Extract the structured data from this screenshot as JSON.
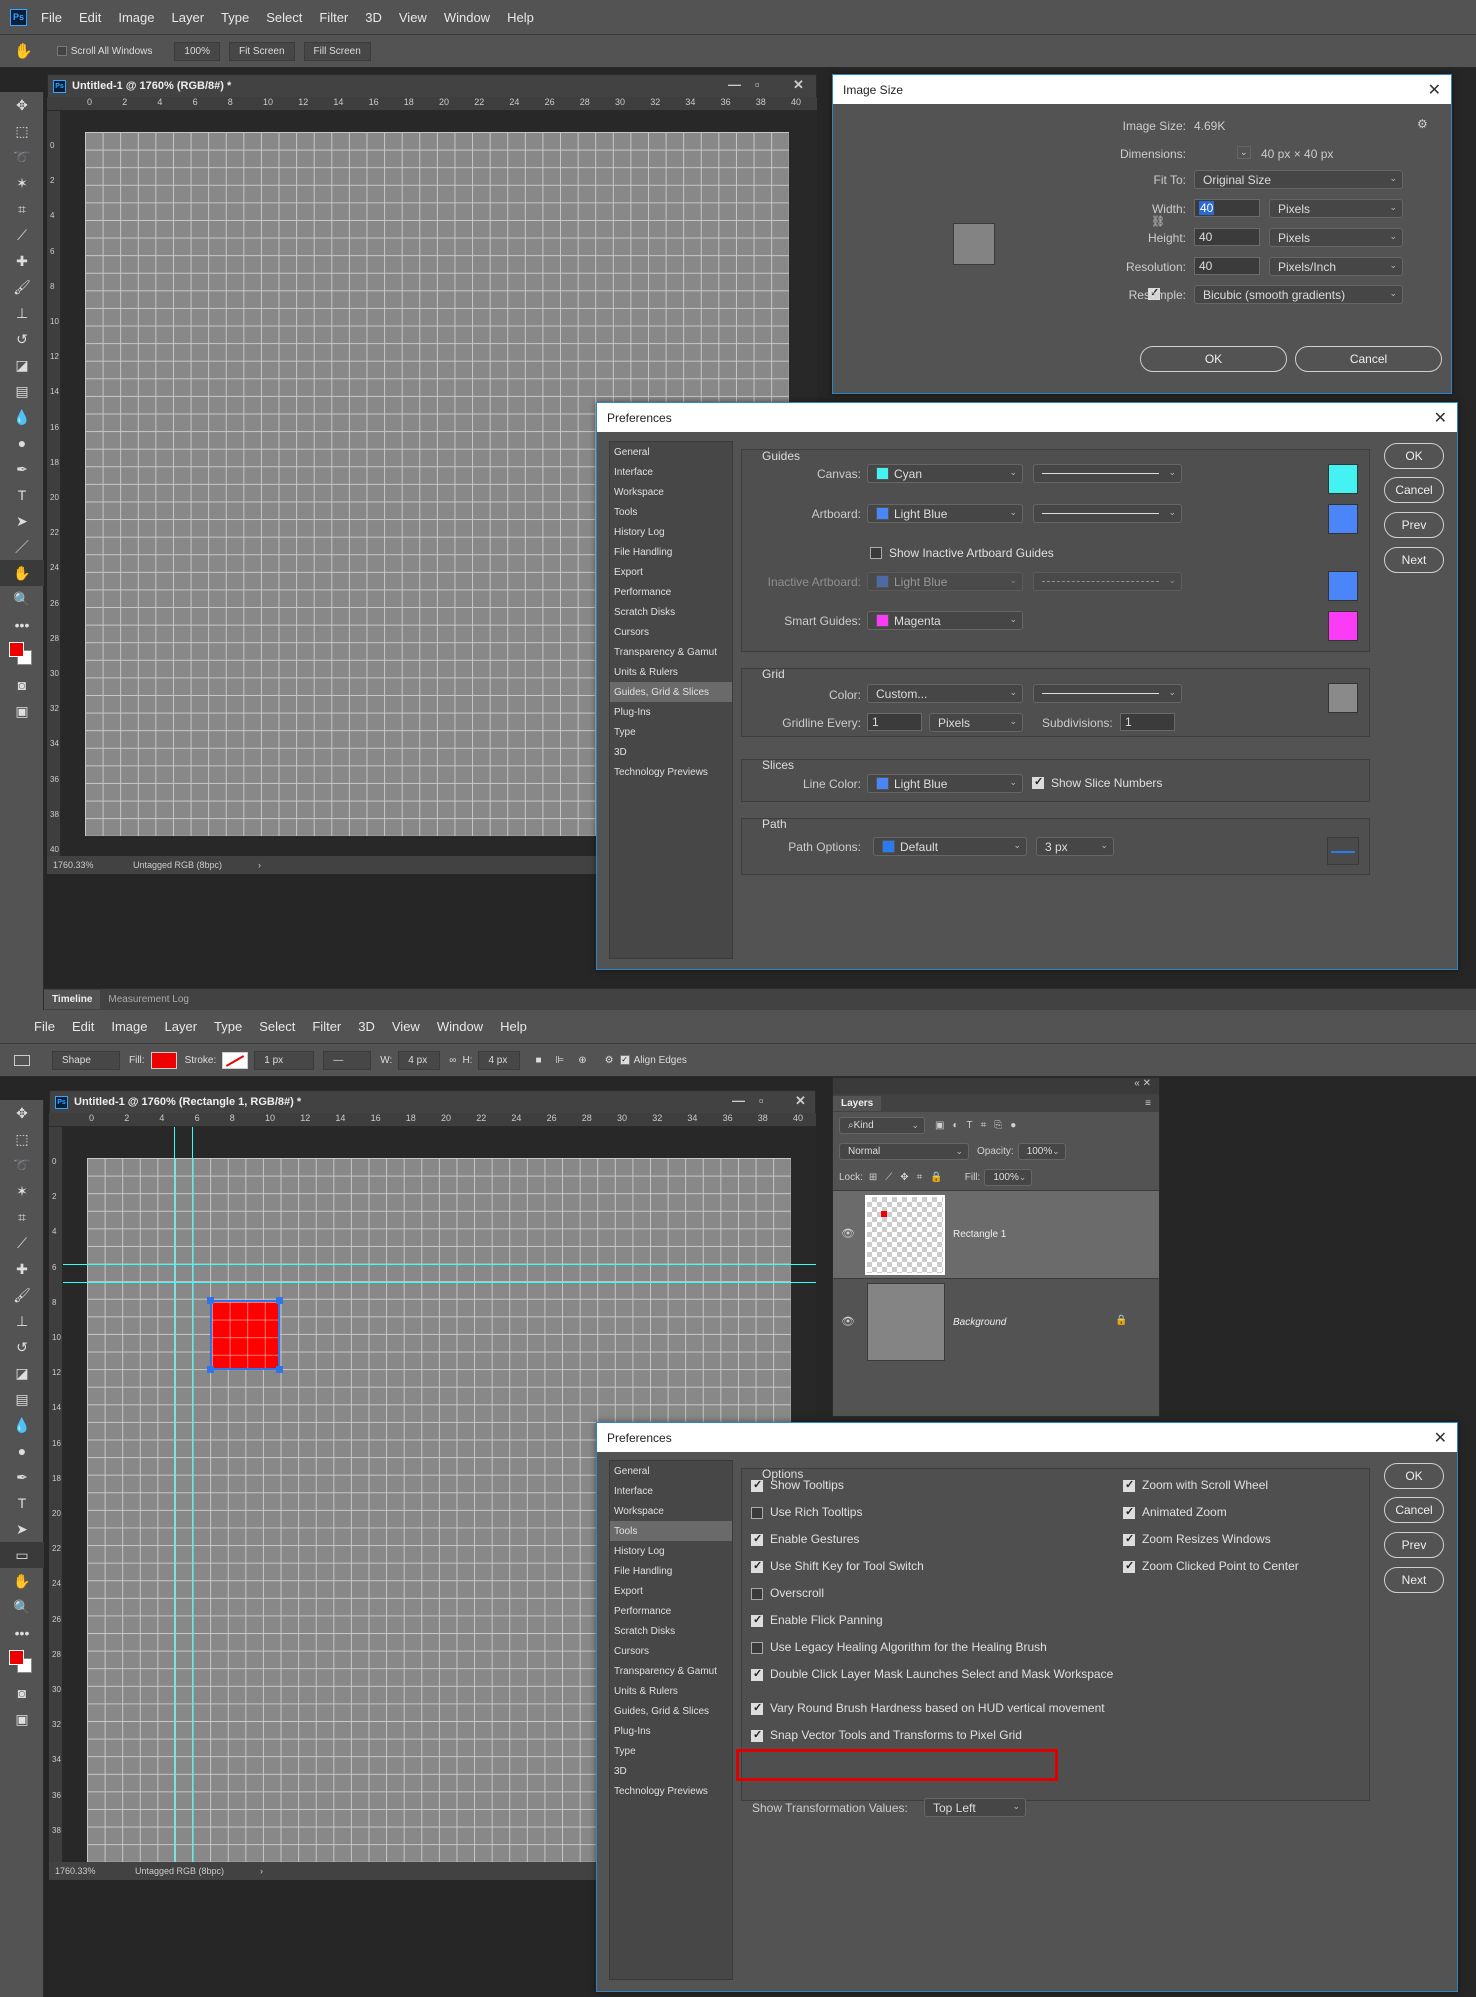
{
  "menu": {
    "items": [
      "File",
      "Edit",
      "Image",
      "Layer",
      "Type",
      "Select",
      "Filter",
      "3D",
      "View",
      "Window",
      "Help"
    ],
    "logo": "Ps"
  },
  "top": {
    "options": {
      "scroll_all": "Scroll All Windows",
      "zoom": "100%",
      "fit": "Fit Screen",
      "fill": "Fill Screen"
    },
    "doc_title": "Untitled-1 @ 1760% (RGB/8#) *",
    "status_zoom": "1760.33%",
    "status_profile": "Untagged RGB (8bpc)",
    "timeline": "Timeline",
    "measurement": "Measurement Log",
    "image_size": {
      "title": "Image Size",
      "size_lbl": "Image Size:",
      "size_val": "4.69K",
      "dims_lbl": "Dimensions:",
      "dims_val": "40 px  ×  40 px",
      "fit_lbl": "Fit To:",
      "fit_val": "Original Size",
      "width_lbl": "Width:",
      "width_val": "40",
      "width_unit": "Pixels",
      "height_lbl": "Height:",
      "height_val": "40",
      "height_unit": "Pixels",
      "res_lbl": "Resolution:",
      "res_val": "40",
      "res_unit": "Pixels/Inch",
      "resample_lbl": "Resample:",
      "resample_val": "Bicubic (smooth gradients)",
      "ok": "OK",
      "cancel": "Cancel"
    },
    "prefs": {
      "title": "Preferences",
      "guides_hdr": "Guides",
      "canvas_lbl": "Canvas:",
      "canvas_val": "Cyan",
      "canvas_color": "#44f2f2",
      "artboard_lbl": "Artboard:",
      "artboard_val": "Light Blue",
      "artboard_color": "#4a86f7",
      "show_inactive": "Show Inactive Artboard Guides",
      "inactive_lbl": "Inactive Artboard:",
      "inactive_val": "Light Blue",
      "smart_lbl": "Smart Guides:",
      "smart_val": "Magenta",
      "smart_color": "#fb3cf6",
      "grid_hdr": "Grid",
      "color_lbl": "Color:",
      "color_val": "Custom...",
      "grid_color": "#8a8a8a",
      "gridline_lbl": "Gridline Every:",
      "gridline_val": "1",
      "gridline_unit": "Pixels",
      "subdiv_lbl": "Subdivisions:",
      "subdiv_val": "1",
      "slices_hdr": "Slices",
      "line_color_lbl": "Line Color:",
      "line_color_val": "Light Blue",
      "show_slice": "Show Slice Numbers",
      "path_hdr": "Path",
      "path_opts_lbl": "Path Options:",
      "path_val": "Default",
      "path_px": "3 px"
    }
  },
  "bottom": {
    "options": {
      "shape": "Shape",
      "fill": "Fill:",
      "stroke": "Stroke:",
      "stroke_w": "1 px",
      "w_lbl": "W:",
      "w_val": "4 px",
      "h_lbl": "H:",
      "h_val": "4 px",
      "align_edges": "Align Edges"
    },
    "doc_title": "Untitled-1 @ 1760% (Rectangle 1, RGB/8#) *",
    "status_zoom": "1760.33%",
    "status_profile": "Untagged RGB (8bpc)",
    "layers": {
      "tab": "Layers",
      "kind": "Kind",
      "blend": "Normal",
      "opacity_lbl": "Opacity:",
      "opacity_val": "100%",
      "lock_lbl": "Lock:",
      "fill_lbl": "Fill:",
      "fill_val": "100%",
      "layer1": "Rectangle 1",
      "layer2": "Background"
    },
    "prefs": {
      "title": "Preferences",
      "options_hdr": "Options",
      "left_opts": [
        {
          "label": "Show Tooltips",
          "checked": true
        },
        {
          "label": "Use Rich Tooltips",
          "checked": false
        },
        {
          "label": "Enable Gestures",
          "checked": true
        },
        {
          "label": "Use Shift Key for Tool Switch",
          "checked": true
        },
        {
          "label": "Overscroll",
          "checked": false
        },
        {
          "label": "Enable Flick Panning",
          "checked": true
        },
        {
          "label": "Use Legacy Healing Algorithm for the Healing Brush",
          "checked": false
        },
        {
          "label": "Double Click Layer Mask Launches Select and Mask Workspace",
          "checked": true
        },
        {
          "label": "Vary Round Brush Hardness based on HUD vertical movement",
          "checked": true
        },
        {
          "label": "Snap Vector Tools and Transforms to Pixel Grid",
          "checked": true
        }
      ],
      "right_opts": [
        {
          "label": "Zoom with Scroll Wheel",
          "checked": true
        },
        {
          "label": "Animated Zoom",
          "checked": true
        },
        {
          "label": "Zoom Resizes Windows",
          "checked": true
        },
        {
          "label": "Zoom Clicked Point to Center",
          "checked": true
        }
      ],
      "transform_lbl": "Show Transformation Values:",
      "transform_val": "Top Left"
    }
  },
  "pref_categories": [
    "General",
    "Interface",
    "Workspace",
    "Tools",
    "History Log",
    "File Handling",
    "Export",
    "Performance",
    "Scratch Disks",
    "Cursors",
    "Transparency & Gamut",
    "Units & Rulers",
    "Guides, Grid & Slices",
    "Plug-Ins",
    "Type",
    "3D",
    "Technology Previews"
  ],
  "pref_buttons": {
    "ok": "OK",
    "cancel": "Cancel",
    "prev": "Prev",
    "next": "Next"
  },
  "ruler": {
    "h": [
      "0",
      "2",
      "4",
      "6",
      "8",
      "10",
      "12",
      "14",
      "16",
      "18",
      "20",
      "22",
      "24",
      "26",
      "28",
      "30",
      "32",
      "34",
      "36",
      "38",
      "40"
    ],
    "v": [
      "0",
      "2",
      "4",
      "6",
      "8",
      "10",
      "12",
      "14",
      "16",
      "18",
      "20",
      "22",
      "24",
      "26",
      "28",
      "30",
      "32",
      "34",
      "36",
      "38",
      "40"
    ]
  },
  "highlight_color": "#e00000"
}
